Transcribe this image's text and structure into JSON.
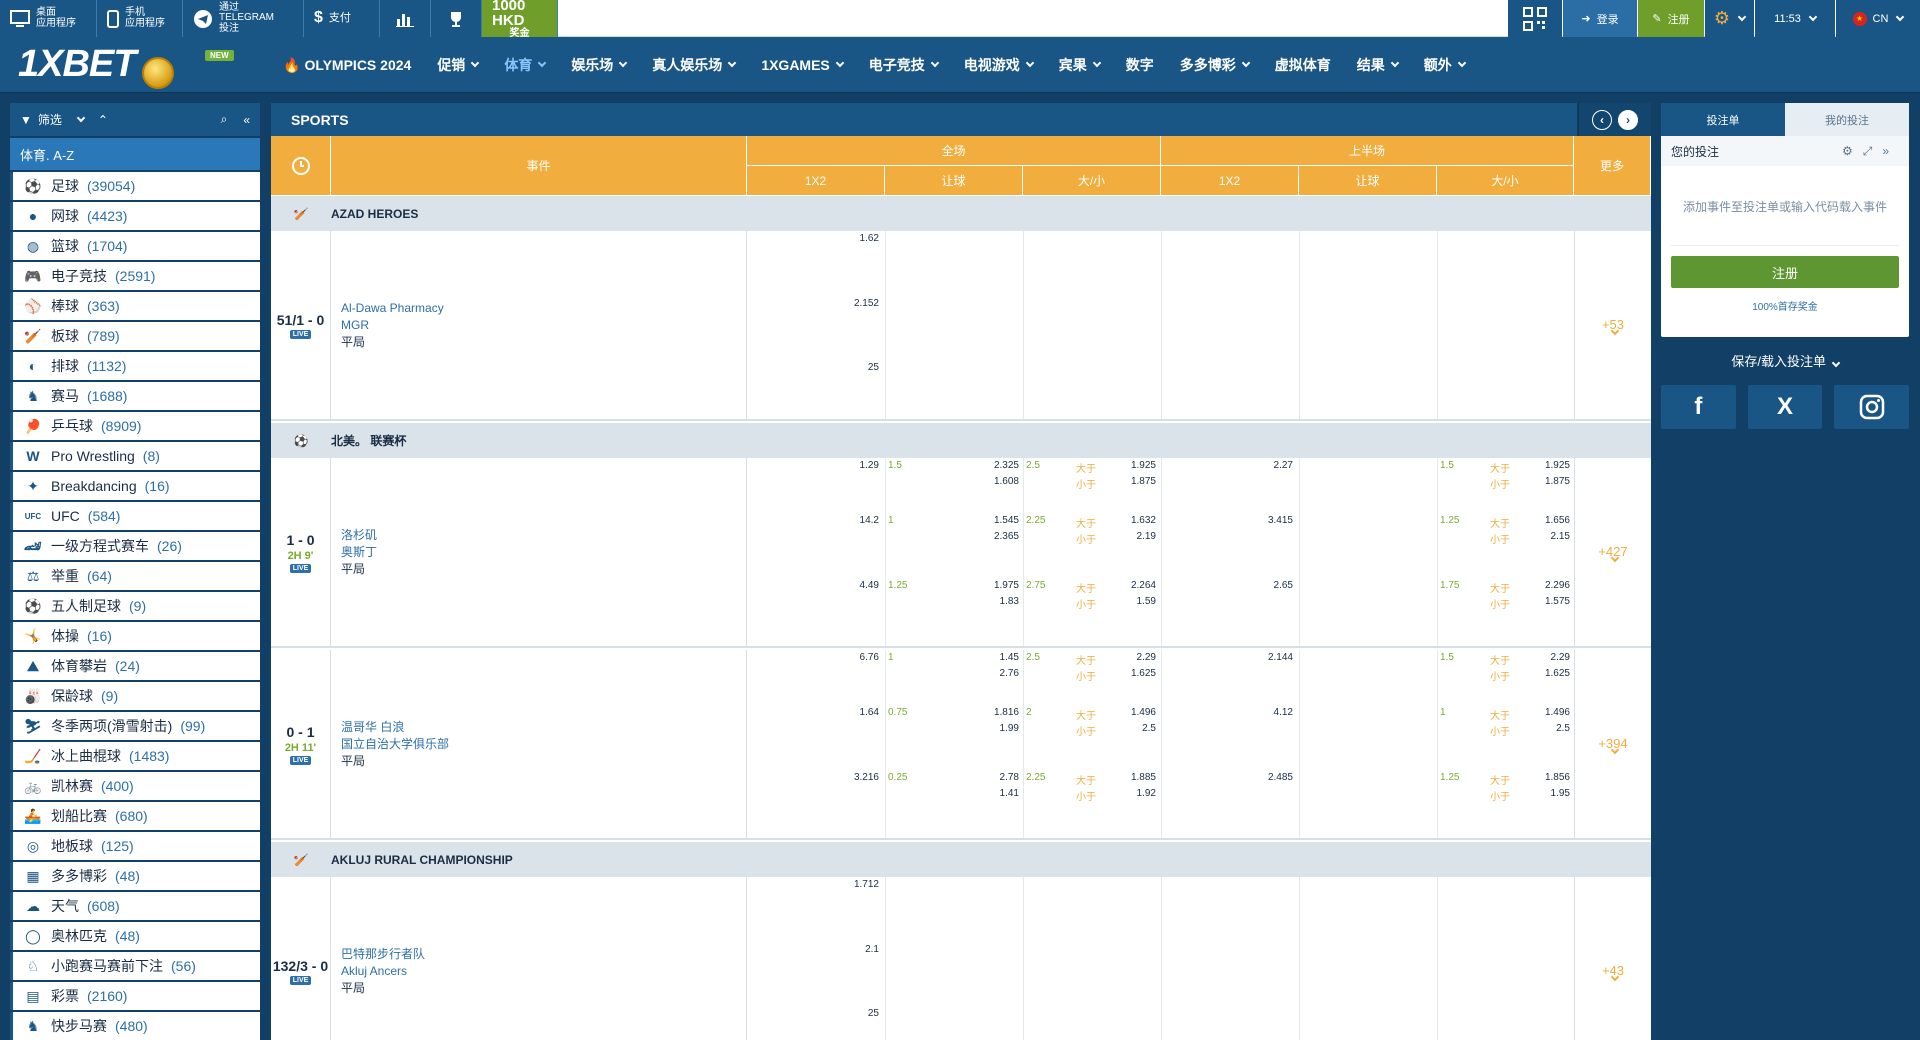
{
  "topbar": {
    "desktop_app": [
      "桌面",
      "应用程序"
    ],
    "mobile_app": [
      "手机",
      "应用程序"
    ],
    "telegram": [
      "通过TELEGRAM",
      "投注"
    ],
    "pay": "支付",
    "promo_amount": "1000 HKD",
    "promo_label": "奖金",
    "login": "登录",
    "register": "注册",
    "time": "11:53",
    "lang": "CN"
  },
  "header": {
    "logo": "1XBET",
    "new_tag": "NEW",
    "nav": [
      "OLYMPICS 2024",
      "促销",
      "体育",
      "娱乐场",
      "真人娱乐场",
      "1XGAMES",
      "电子竞技",
      "电视游戏",
      "宾果",
      "数字",
      "多多博彩",
      "虚拟体育",
      "结果",
      "额外"
    ]
  },
  "sidebar": {
    "filter": "筛选",
    "az": "体育. A-Z",
    "sports": [
      {
        "name": "足球",
        "count": "(39054)",
        "icon": "soccer-icon"
      },
      {
        "name": "网球",
        "count": "(4423)",
        "icon": "tennis-icon"
      },
      {
        "name": "篮球",
        "count": "(1704)",
        "icon": "basketball-icon"
      },
      {
        "name": "电子竞技",
        "count": "(2591)",
        "icon": "gamepad-icon"
      },
      {
        "name": "棒球",
        "count": "(363)",
        "icon": "baseball-icon"
      },
      {
        "name": "板球",
        "count": "(789)",
        "icon": "cricket-icon"
      },
      {
        "name": "排球",
        "count": "(1132)",
        "icon": "volleyball-icon"
      },
      {
        "name": "赛马",
        "count": "(1688)",
        "icon": "horse-icon"
      },
      {
        "name": "乒乓球",
        "count": "(8909)",
        "icon": "table-tennis-icon"
      },
      {
        "name": "Pro Wrestling",
        "count": "(8)",
        "icon": "wrestling-icon"
      },
      {
        "name": "Breakdancing",
        "count": "(16)",
        "icon": "breakdance-icon"
      },
      {
        "name": "UFC",
        "count": "(584)",
        "icon": "ufc-icon"
      },
      {
        "name": "一级方程式赛车",
        "count": "(26)",
        "icon": "f1-icon"
      },
      {
        "name": "举重",
        "count": "(64)",
        "icon": "weightlifting-icon"
      },
      {
        "name": "五人制足球",
        "count": "(9)",
        "icon": "futsal-icon"
      },
      {
        "name": "体操",
        "count": "(16)",
        "icon": "gymnastics-icon"
      },
      {
        "name": "体育攀岩",
        "count": "(24)",
        "icon": "climbing-icon"
      },
      {
        "name": "保龄球",
        "count": "(9)",
        "icon": "bowling-icon"
      },
      {
        "name": "冬季两项(滑雪射击)",
        "count": "(99)",
        "icon": "biathlon-icon"
      },
      {
        "name": "冰上曲棍球",
        "count": "(1483)",
        "icon": "hockey-icon"
      },
      {
        "name": "凯林赛",
        "count": "(400)",
        "icon": "cycling-icon"
      },
      {
        "name": "划船比赛",
        "count": "(680)",
        "icon": "rowing-icon"
      },
      {
        "name": "地板球",
        "count": "(125)",
        "icon": "floorball-icon"
      },
      {
        "name": "多多博彩",
        "count": "(48)",
        "icon": "toto-icon"
      },
      {
        "name": "天气",
        "count": "(608)",
        "icon": "weather-icon"
      },
      {
        "name": "奥林匹克",
        "count": "(48)",
        "icon": "olympics-icon"
      },
      {
        "name": "小跑赛马赛前下注",
        "count": "(56)",
        "icon": "trotting-icon"
      },
      {
        "name": "彩票",
        "count": "(2160)",
        "icon": "lottery-icon"
      },
      {
        "name": "快步马赛",
        "count": "(480)",
        "icon": "harness-icon"
      }
    ]
  },
  "main": {
    "title": "SPORTS",
    "headers": {
      "event": "事件",
      "full": "全场",
      "half": "上半场",
      "more": "更多",
      "sub": [
        "1X2",
        "让球",
        "大/小",
        "1X2",
        "让球",
        "大/小"
      ]
    },
    "leagues": [
      "AZAD HEROES",
      "北美。 联赛杯",
      "AKLUJ RURAL CHAMPIONSHIP"
    ],
    "events": [
      {
        "score": "51/1 - 0",
        "clock": "",
        "team1": "Al-Dawa Pharmacy",
        "team2": "MGR",
        "draw": "平局",
        "more": "+53",
        "odds": [
          [
            "1.62",
            "",
            "",
            "",
            "",
            "",
            "",
            "",
            "",
            ""
          ],
          [
            "2.152",
            "",
            "",
            "",
            "",
            "",
            "",
            "",
            "",
            ""
          ],
          [
            "25",
            "",
            "",
            "",
            "",
            "",
            "",
            "",
            "",
            ""
          ]
        ]
      },
      {
        "score": "1 - 0",
        "clock": "2H 9'",
        "team1": "洛杉矶",
        "team2": "奥斯丁",
        "draw": "平局",
        "more": "+427",
        "lines": [
          [
            "1.29",
            "1.5",
            "2.325",
            "1.608",
            "2.5",
            "大于",
            "小于",
            "1.925",
            "1.875",
            "2.27",
            "1.5",
            "大于",
            "小于",
            "1.925",
            "1.875"
          ],
          [
            "14.2",
            "1",
            "1.545",
            "2.365",
            "2.25",
            "大于",
            "小于",
            "1.632",
            "2.19",
            "3.415",
            "1.25",
            "大于",
            "小于",
            "1.656",
            "2.15"
          ],
          [
            "4.49",
            "1.25",
            "1.975",
            "1.83",
            "2.75",
            "大于",
            "小于",
            "2.264",
            "1.59",
            "2.65",
            "1.75",
            "大于",
            "小于",
            "2.296",
            "1.575"
          ]
        ]
      },
      {
        "score": "0 - 1",
        "clock": "2H 11'",
        "team1": "温哥华 白浪",
        "team2": "国立自治大学俱乐部",
        "draw": "平局",
        "more": "+394",
        "lines": [
          [
            "6.76",
            "1",
            "1.45",
            "2.76",
            "2.5",
            "大于",
            "小于",
            "2.29",
            "1.625",
            "2.144",
            "1.5",
            "大于",
            "小于",
            "2.29",
            "1.625"
          ],
          [
            "1.64",
            "0.75",
            "1.816",
            "1.99",
            "2",
            "大于",
            "小于",
            "1.496",
            "2.5",
            "4.12",
            "1",
            "大于",
            "小于",
            "1.496",
            "2.5"
          ],
          [
            "3.216",
            "0.25",
            "2.78",
            "1.41",
            "2.25",
            "大于",
            "小于",
            "1.885",
            "1.92",
            "2.485",
            "1.25",
            "大于",
            "小于",
            "1.856",
            "1.95"
          ]
        ]
      },
      {
        "score": "132/3 - 0",
        "clock": "",
        "team1": "巴特那步行者队",
        "team2": "Akluj Ancers",
        "draw": "平局",
        "more": "+43",
        "odds": [
          [
            "1.712"
          ],
          [
            "2.1"
          ],
          [
            "25"
          ]
        ]
      }
    ]
  },
  "betslip": {
    "tab1": "投注单",
    "tab2": "我的投注",
    "your_bets": "您的投注",
    "empty": "添加事件至投注单或输入代码载入事件",
    "register": "注册",
    "bonus": "100%首存奖金",
    "save_load": "保存/载入投注单"
  },
  "social": [
    "f",
    "X",
    "IG"
  ],
  "colors": {
    "primary": "#1a5685",
    "accent": "#f2ad3f",
    "green": "#6f9e2b",
    "bg": "#123f66"
  }
}
